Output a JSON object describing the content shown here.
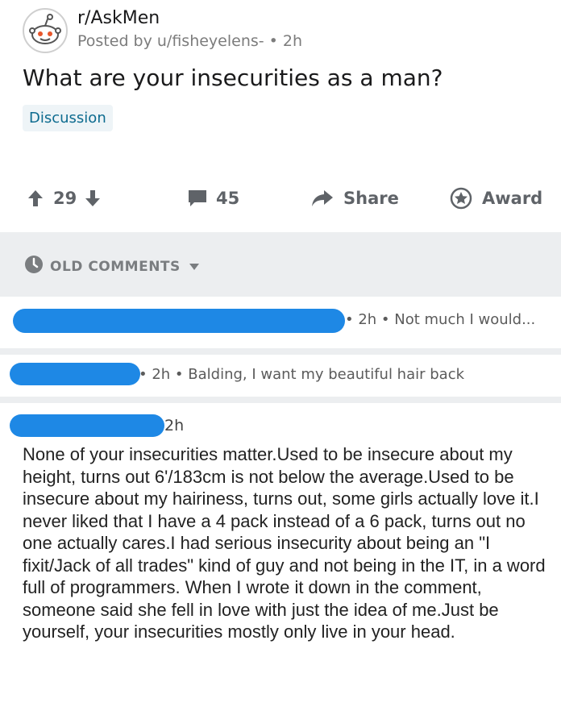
{
  "post": {
    "subreddit": "r/AskMen",
    "byline": "Posted by u/fisheyelens- • 2h",
    "title": "What are your insecurities as a man?",
    "flair": "Discussion",
    "votes": "29",
    "comments_count": "45",
    "share_label": "Share",
    "award_label": "Award"
  },
  "sort": {
    "label": "OLD COMMENTS"
  },
  "comments": [
    {
      "meta": "• 2h • Not much I would..."
    },
    {
      "meta": "• 2h • Balding, I want my beautiful hair back"
    },
    {
      "meta": "2h",
      "body": "None of your insecurities matter.Used to be insecure about my height, turns out 6'/183cm is not below the average.Used to be insecure about my hairiness, turns out, some girls actually love it.I never liked that I have a 4 pack instead of a 6 pack, turns out no one actually cares.I had serious insecurity about being an \"I fixit/Jack of all trades\" kind of guy and not being in the IT, in a word full of programmers. When I wrote it down in the comment, someone said she fell in love with just the idea of me.Just be yourself, your insecurities mostly only live in your head."
    }
  ],
  "colors": {
    "redaction": "#1e88e5",
    "flair_text": "#0d6b8f",
    "flair_bg": "#eef4f7",
    "divider": "#eceef0"
  },
  "icons": [
    "subreddit-avatar-icon",
    "upvote-icon",
    "downvote-icon",
    "comment-icon",
    "share-icon",
    "award-icon",
    "clock-icon",
    "caret-down-icon"
  ]
}
